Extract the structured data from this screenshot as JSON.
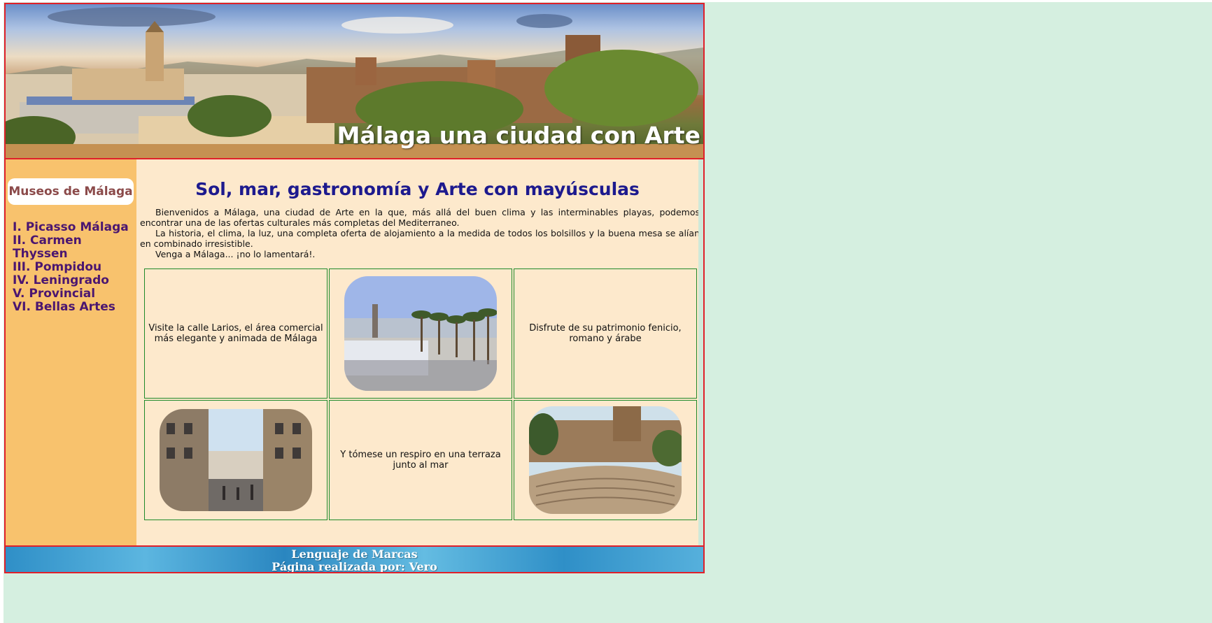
{
  "header": {
    "title": "Málaga una ciudad con Arte"
  },
  "sidebar": {
    "title": "Museos de Málaga",
    "items": [
      {
        "num": "I.",
        "label": "Picasso Málaga"
      },
      {
        "num": "II.",
        "label": "Carmen Thyssen"
      },
      {
        "num": "III.",
        "label": "Pompidou"
      },
      {
        "num": "IV.",
        "label": "Leningrado"
      },
      {
        "num": "V.",
        "label": "Provincial"
      },
      {
        "num": "VI.",
        "label": "Bellas Artes"
      }
    ]
  },
  "main": {
    "title": "Sol, mar, gastronomía y Arte con mayúsculas",
    "paragraphs": [
      "Bienvenidos a Málaga, una ciudad de Arte en la que, más allá del buen clima y las interminables playas, podemos encontrar una de las ofertas culturales más completas del Mediterraneo.",
      "La historia, el clima, la luz, una completa oferta de alojamiento a la medida de todos los bolsillos y la buena mesa se alían en combinado irresistible.",
      "Venga a Málaga... ¡no lo lamentará!."
    ],
    "cells": {
      "larios_text": "Visite la calle Larios, el área comercial más elegante y animada de Málaga",
      "patrimonio_text": "Disfrute de su patrimonio fenicio, romano y árabe",
      "terraza_text": "Y tómese un respiro en una terraza junto al mar"
    }
  },
  "footer": {
    "line1": "Lenguaje de Marcas",
    "line2": "Página realizada por: Vero"
  },
  "colors": {
    "border": "#e0202a",
    "sidebar_bg": "#f8c26d",
    "main_bg": "#fde9cc",
    "page_bg": "#d5efe0",
    "title_blue": "#1d1a8e",
    "menu_purple": "#4b1670",
    "cell_border": "#1f8a2a"
  }
}
